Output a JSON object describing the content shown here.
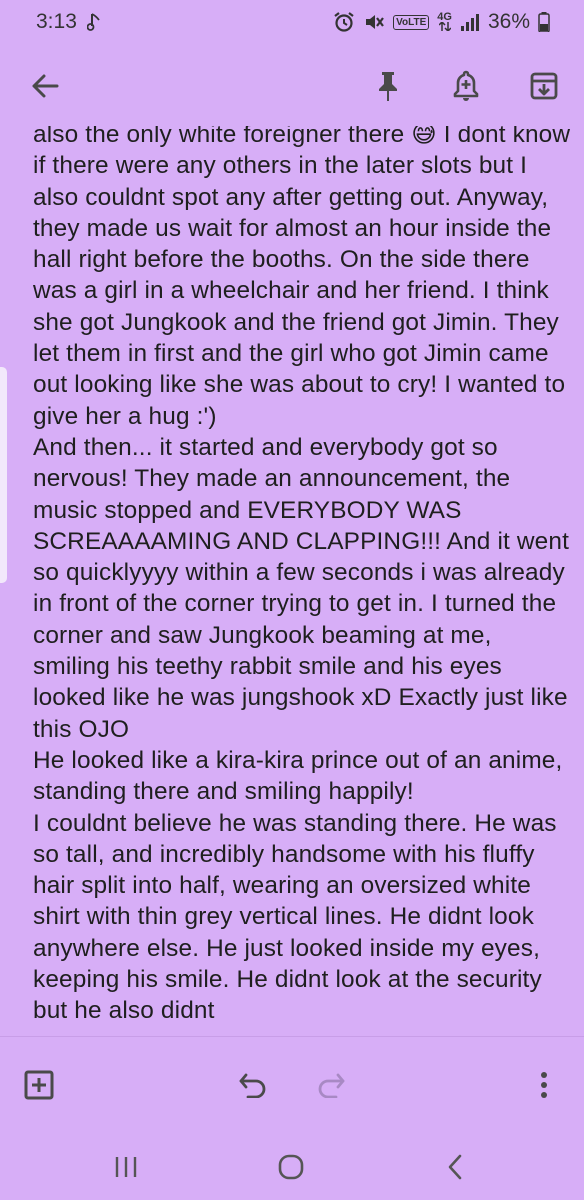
{
  "status_bar": {
    "time": "3:13",
    "network_type": "4G",
    "volte_label": "VoLTE",
    "battery": "36%"
  },
  "toolbar": {
    "back_icon": "arrow-left-icon",
    "pin_icon": "pin-icon",
    "reminder_icon": "bell-plus-icon",
    "archive_icon": "archive-icon"
  },
  "note": {
    "body": "also the only white foreigner there 😅 I dont know if there were any others in the later slots but I also couldnt spot any after getting out. Anyway, they made us wait for almost an hour inside the hall right before the booths. On the side there was a girl in a wheelchair and her friend. I think she got Jungkook and the friend got Jimin. They let them in first and the girl who got Jimin came out looking like she was about to cry! I wanted to give her a hug :')\nAnd then... it started and everybody got so nervous! They made an announcement, the music stopped and EVERYBODY WAS SCREAAAAMING AND CLAPPING!!! And it went so quicklyyyy within a few seconds i was already in front of the corner trying to get in. I turned the corner and saw Jungkook beaming at me, smiling his teethy rabbit smile and his eyes looked like he was jungshook xD Exactly just like this OJO\nHe looked like a kira-kira prince out of an anime, standing there and smiling happily!\nI couldnt believe he was standing there. He was so tall, and incredibly handsome with his fluffy hair split into half, wearing an oversized white shirt with thin grey vertical lines. He didnt look anywhere else. He just looked inside my eyes, keeping his smile. He didnt look at the security but he also didnt"
  },
  "bottom_toolbar": {
    "add_icon": "add-box-icon",
    "undo_icon": "undo-icon",
    "redo_icon": "redo-icon",
    "more_icon": "more-vertical-icon"
  },
  "nav_bar": {
    "recents_icon": "recents-icon",
    "home_icon": "home-icon",
    "back_icon": "nav-back-icon"
  },
  "colors": {
    "background": "#d7aef7",
    "icon": "#4a4a4a",
    "text": "#1f1f1f"
  }
}
